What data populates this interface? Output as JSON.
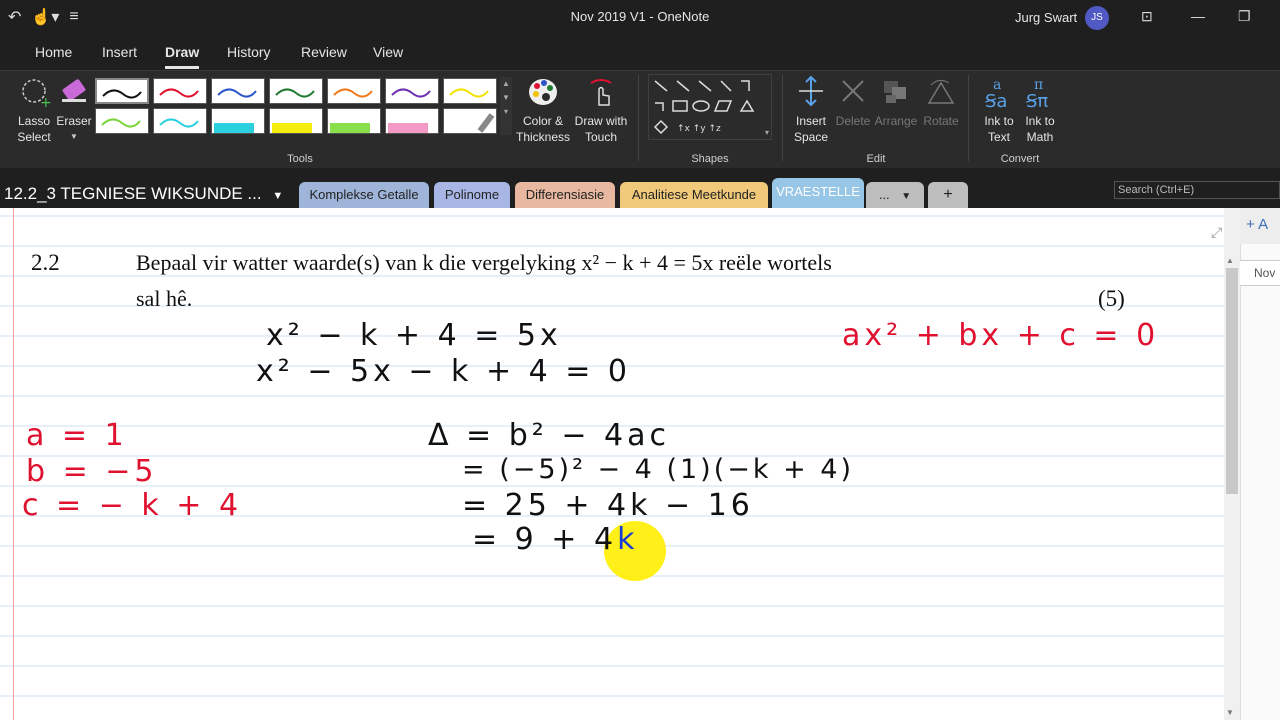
{
  "window": {
    "title": "Nov 2019 V1  -  OneNote",
    "user_name": "Jurg Swart",
    "user_initials": "JS"
  },
  "menu": [
    "Home",
    "Insert",
    "Draw",
    "History",
    "Review",
    "View"
  ],
  "menu_active": "Draw",
  "ribbon": {
    "lasso_label_1": "Lasso",
    "lasso_label_2": "Select",
    "eraser_label": "Eraser",
    "color_thickness_1": "Color &",
    "color_thickness_2": "Thickness",
    "draw_touch_1": "Draw with",
    "draw_touch_2": "Touch",
    "insert_space_1": "Insert",
    "insert_space_2": "Space",
    "delete_label": "Delete",
    "arrange_label": "Arrange",
    "rotate_label": "Rotate",
    "ink_text_1": "Ink to",
    "ink_text_2": "Text",
    "ink_math_1": "Ink to",
    "ink_math_2": "Math",
    "group_tools": "Tools",
    "group_shapes": "Shapes",
    "group_edit": "Edit",
    "group_convert": "Convert"
  },
  "pens": {
    "row1": [
      "#111111",
      "#e0102f",
      "#2a55c8",
      "#1f7a2e",
      "#f07a1a",
      "#6b2fb0",
      "#f2e200"
    ],
    "row2": [
      "#7ad43a",
      "#2ad0e0",
      "#2ad0e0",
      "#f6ee10",
      "#88e04a",
      "#f59ac4",
      "#e8e8e8"
    ]
  },
  "notebook": {
    "name": "12.2_3 TEGNIESE WIKSUNDE ...",
    "sections": [
      {
        "label": "Komplekse Getalle",
        "color": "#9fb4d9"
      },
      {
        "label": "Polinome",
        "color": "#a8b6e6"
      },
      {
        "label": "Differensiasie",
        "color": "#e8b8a0"
      },
      {
        "label": "Analitiese Meetkunde",
        "color": "#f0c97a"
      },
      {
        "label": "VRAESTELLE",
        "color": "#98c6e6"
      },
      {
        "label": "...",
        "color": "#bdbdbd"
      },
      {
        "label": "+",
        "color": "#bdbdbd"
      }
    ],
    "search_placeholder": "Search (Ctrl+E)"
  },
  "pages_panel": {
    "add_label": "+ A",
    "page_label": "Nov"
  },
  "question": {
    "number": "2.2",
    "line1": "Bepaal vir watter waarde(s) van  k  die vergelyking   x² − k + 4 = 5x   reële wortels",
    "line2": "sal hê.",
    "marks": "(5)"
  },
  "ink": {
    "eq1": "x² − k + 4  = 5x",
    "eq2": "x² − 5x  − k + 4  = 0",
    "standard_form": "ax² + bx + c = 0",
    "coef_a": "a =  1",
    "coef_b": "b =  −5",
    "coef_c": "c =  − k + 4",
    "delta1": "Δ = b² − 4ac",
    "delta2": "= (−5)² − 4 (1)(−k + 4)",
    "delta3": "= 25 + 4k − 16",
    "delta4_prefix": "=  9  + 4",
    "delta4_k": "k"
  }
}
